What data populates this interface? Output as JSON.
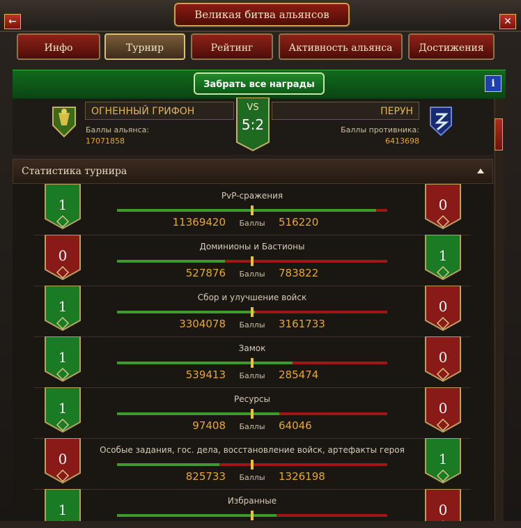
{
  "window": {
    "title": "Великая битва альянсов"
  },
  "tabs": [
    {
      "label": "Инфо",
      "active": false
    },
    {
      "label": "Турнир",
      "active": true
    },
    {
      "label": "Рейтинг",
      "active": false
    },
    {
      "label": "Активность альянса",
      "active": false
    },
    {
      "label": "Достижения",
      "active": false
    }
  ],
  "claim_all_label": "Забрать все награды",
  "info_label": "i",
  "match": {
    "vs_label": "VS",
    "score": "5:2",
    "left": {
      "name": "ОГНЕННЫЙ ГРИФОН",
      "points_label": "Баллы альянса:",
      "points": "17071858"
    },
    "right": {
      "name": "ПЕРУН",
      "points_label": "Баллы противника:",
      "points": "6413698"
    }
  },
  "stats": {
    "header": "Статистика турнира",
    "points_label": "Баллы",
    "rows": [
      {
        "title": "PvP-сражения",
        "left_score": "1",
        "right_score": "0",
        "left_value": "11369420",
        "right_value": "516220",
        "left_share": 0.96
      },
      {
        "title": "Доминионы и Бастионы",
        "left_score": "0",
        "right_score": "1",
        "left_value": "527876",
        "right_value": "783822",
        "left_share": 0.4
      },
      {
        "title": "Сбор и улучшение войск",
        "left_score": "1",
        "right_score": "0",
        "left_value": "3304078",
        "right_value": "3161733",
        "left_share": 0.51
      },
      {
        "title": "Замок",
        "left_score": "1",
        "right_score": "0",
        "left_value": "539413",
        "right_value": "285474",
        "left_share": 0.65
      },
      {
        "title": "Ресурсы",
        "left_score": "1",
        "right_score": "0",
        "left_value": "97408",
        "right_value": "64046",
        "left_share": 0.6
      },
      {
        "title": "Особые задания, гос. дела, восстановление войск, артефакты героя",
        "left_score": "0",
        "right_score": "1",
        "left_value": "825733",
        "right_value": "1326198",
        "left_share": 0.38
      },
      {
        "title": "Избранные",
        "left_score": "1",
        "right_score": "0",
        "left_value": "",
        "right_value": "",
        "left_share": 0.59
      }
    ]
  },
  "colors": {
    "win": "#1b7a24",
    "lose": "#8a1a18",
    "gold": "#e8a830"
  }
}
